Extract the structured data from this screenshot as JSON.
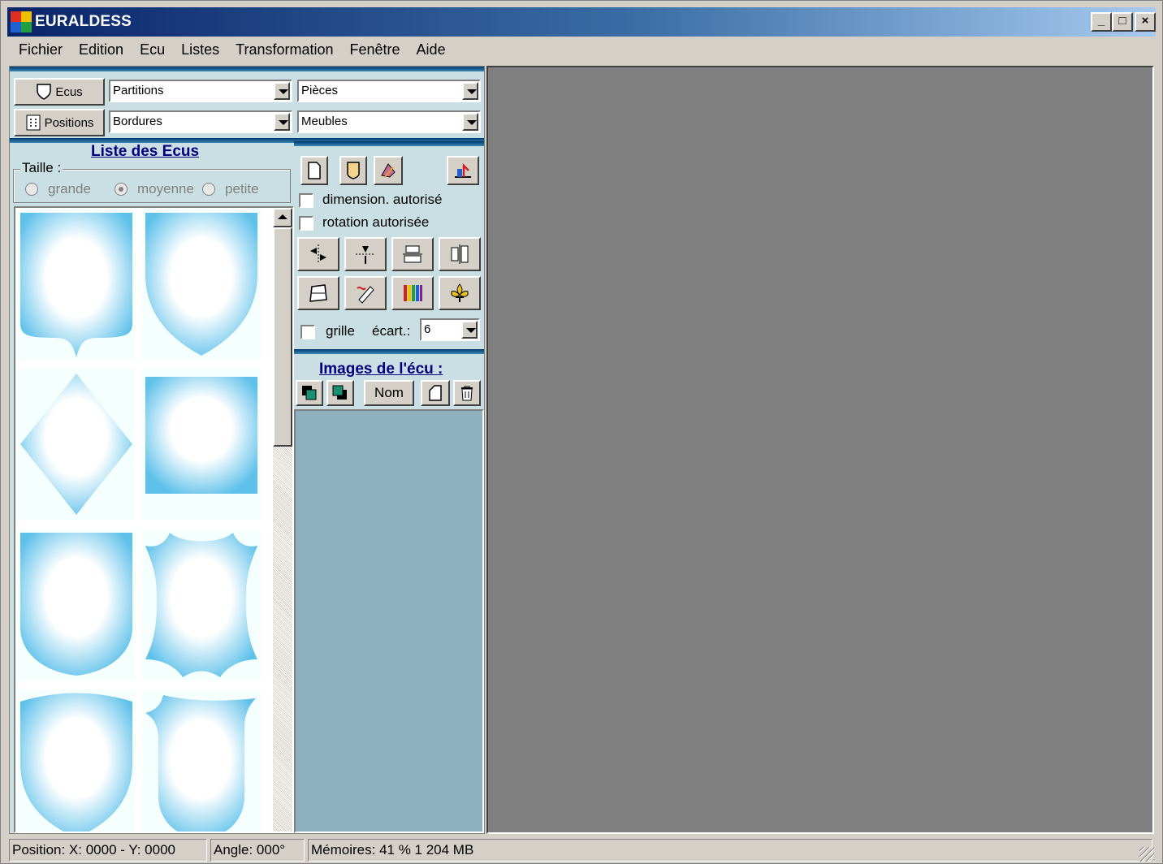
{
  "window": {
    "title": "EURALDESS",
    "min_label": "_",
    "max_label": "□",
    "close_label": "×"
  },
  "menu": [
    "Fichier",
    "Edition",
    "Ecu",
    "Listes",
    "Transformation",
    "Fenêtre",
    "Aide"
  ],
  "toolbar": {
    "ecus_label": "Ecus",
    "positions_label": "Positions",
    "combo_partitions": "Partitions",
    "combo_bordures": "Bordures",
    "combo_pieces": "Pièces",
    "combo_meubles": "Meubles"
  },
  "ecus_list": {
    "title": "Liste des Ecus",
    "size_group_label": "Taille :",
    "size_options": [
      "grande",
      "moyenne",
      "petite"
    ],
    "selected_size": "moyenne"
  },
  "options": {
    "dimension_label": "dimension. autorisé",
    "rotation_label": "rotation autorisée",
    "grid_label": "grille",
    "spacing_label": "écart.:",
    "spacing_value": "6"
  },
  "images": {
    "title": "Images de l'écu :",
    "name_button": "Nom"
  },
  "status": {
    "position": "Position: X: 0000 - Y: 0000",
    "angle": "Angle: 000°",
    "memory": "Mémoires: 41 % 1 204 MB"
  },
  "colors": {
    "titlebar_start": "#0a246a",
    "titlebar_end": "#a6caf0",
    "section_title": "#00007f",
    "shield_blue": "#5fc1ea",
    "canvas": "#808080"
  }
}
